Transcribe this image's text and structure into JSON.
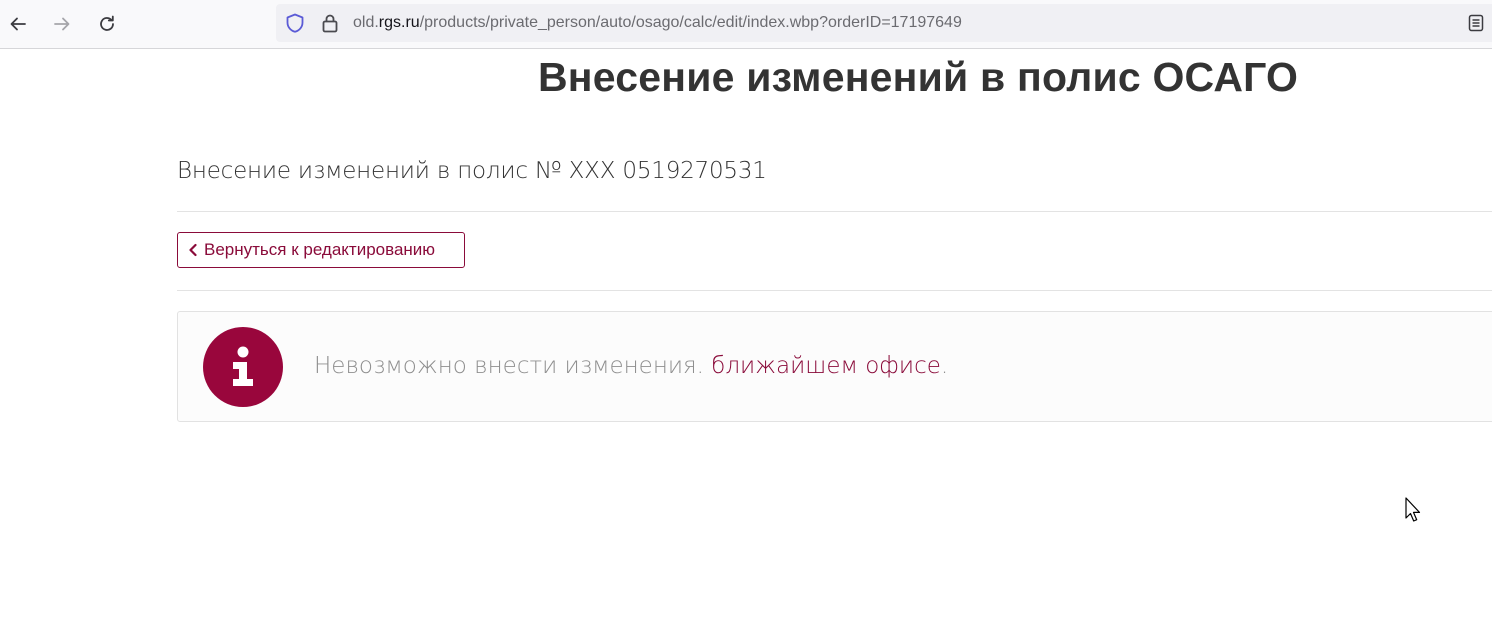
{
  "browser": {
    "url_prefix": "old.",
    "url_domain": "rgs.ru",
    "url_path": "/products/private_person/auto/osago/calc/edit/index.wbp?orderID=17197649",
    "icons": [
      "back-icon",
      "forward-icon",
      "reload-icon",
      "shield-icon",
      "lock-icon",
      "reader-view-icon"
    ]
  },
  "page": {
    "title": "Внесение изменений в полис ОСАГО",
    "subtitle": "Внесение изменений в полис № XXX 0519270531",
    "back_button": "Вернуться к редактированию",
    "info": {
      "message": "Невозможно внести изменения. ",
      "link_text": "ближайшем офисе",
      "after_link": "."
    }
  },
  "colors": {
    "accent": "#8a0b3a",
    "info_icon_bg": "#99063c"
  }
}
